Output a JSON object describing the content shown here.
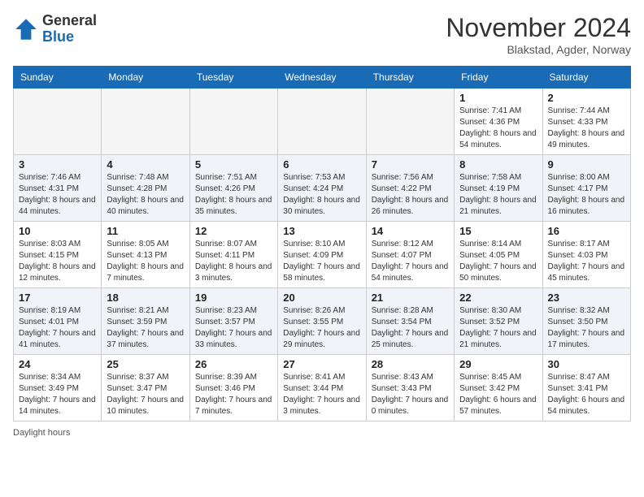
{
  "header": {
    "logo_general": "General",
    "logo_blue": "Blue",
    "month_title": "November 2024",
    "location": "Blakstad, Agder, Norway"
  },
  "days_of_week": [
    "Sunday",
    "Monday",
    "Tuesday",
    "Wednesday",
    "Thursday",
    "Friday",
    "Saturday"
  ],
  "footer": {
    "daylight_label": "Daylight hours"
  },
  "weeks": [
    [
      {
        "day": "",
        "info": ""
      },
      {
        "day": "",
        "info": ""
      },
      {
        "day": "",
        "info": ""
      },
      {
        "day": "",
        "info": ""
      },
      {
        "day": "",
        "info": ""
      },
      {
        "day": "1",
        "info": "Sunrise: 7:41 AM\nSunset: 4:36 PM\nDaylight: 8 hours\nand 54 minutes."
      },
      {
        "day": "2",
        "info": "Sunrise: 7:44 AM\nSunset: 4:33 PM\nDaylight: 8 hours\nand 49 minutes."
      }
    ],
    [
      {
        "day": "3",
        "info": "Sunrise: 7:46 AM\nSunset: 4:31 PM\nDaylight: 8 hours\nand 44 minutes."
      },
      {
        "day": "4",
        "info": "Sunrise: 7:48 AM\nSunset: 4:28 PM\nDaylight: 8 hours\nand 40 minutes."
      },
      {
        "day": "5",
        "info": "Sunrise: 7:51 AM\nSunset: 4:26 PM\nDaylight: 8 hours\nand 35 minutes."
      },
      {
        "day": "6",
        "info": "Sunrise: 7:53 AM\nSunset: 4:24 PM\nDaylight: 8 hours\nand 30 minutes."
      },
      {
        "day": "7",
        "info": "Sunrise: 7:56 AM\nSunset: 4:22 PM\nDaylight: 8 hours\nand 26 minutes."
      },
      {
        "day": "8",
        "info": "Sunrise: 7:58 AM\nSunset: 4:19 PM\nDaylight: 8 hours\nand 21 minutes."
      },
      {
        "day": "9",
        "info": "Sunrise: 8:00 AM\nSunset: 4:17 PM\nDaylight: 8 hours\nand 16 minutes."
      }
    ],
    [
      {
        "day": "10",
        "info": "Sunrise: 8:03 AM\nSunset: 4:15 PM\nDaylight: 8 hours\nand 12 minutes."
      },
      {
        "day": "11",
        "info": "Sunrise: 8:05 AM\nSunset: 4:13 PM\nDaylight: 8 hours\nand 7 minutes."
      },
      {
        "day": "12",
        "info": "Sunrise: 8:07 AM\nSunset: 4:11 PM\nDaylight: 8 hours\nand 3 minutes."
      },
      {
        "day": "13",
        "info": "Sunrise: 8:10 AM\nSunset: 4:09 PM\nDaylight: 7 hours\nand 58 minutes."
      },
      {
        "day": "14",
        "info": "Sunrise: 8:12 AM\nSunset: 4:07 PM\nDaylight: 7 hours\nand 54 minutes."
      },
      {
        "day": "15",
        "info": "Sunrise: 8:14 AM\nSunset: 4:05 PM\nDaylight: 7 hours\nand 50 minutes."
      },
      {
        "day": "16",
        "info": "Sunrise: 8:17 AM\nSunset: 4:03 PM\nDaylight: 7 hours\nand 45 minutes."
      }
    ],
    [
      {
        "day": "17",
        "info": "Sunrise: 8:19 AM\nSunset: 4:01 PM\nDaylight: 7 hours\nand 41 minutes."
      },
      {
        "day": "18",
        "info": "Sunrise: 8:21 AM\nSunset: 3:59 PM\nDaylight: 7 hours\nand 37 minutes."
      },
      {
        "day": "19",
        "info": "Sunrise: 8:23 AM\nSunset: 3:57 PM\nDaylight: 7 hours\nand 33 minutes."
      },
      {
        "day": "20",
        "info": "Sunrise: 8:26 AM\nSunset: 3:55 PM\nDaylight: 7 hours\nand 29 minutes."
      },
      {
        "day": "21",
        "info": "Sunrise: 8:28 AM\nSunset: 3:54 PM\nDaylight: 7 hours\nand 25 minutes."
      },
      {
        "day": "22",
        "info": "Sunrise: 8:30 AM\nSunset: 3:52 PM\nDaylight: 7 hours\nand 21 minutes."
      },
      {
        "day": "23",
        "info": "Sunrise: 8:32 AM\nSunset: 3:50 PM\nDaylight: 7 hours\nand 17 minutes."
      }
    ],
    [
      {
        "day": "24",
        "info": "Sunrise: 8:34 AM\nSunset: 3:49 PM\nDaylight: 7 hours\nand 14 minutes."
      },
      {
        "day": "25",
        "info": "Sunrise: 8:37 AM\nSunset: 3:47 PM\nDaylight: 7 hours\nand 10 minutes."
      },
      {
        "day": "26",
        "info": "Sunrise: 8:39 AM\nSunset: 3:46 PM\nDaylight: 7 hours\nand 7 minutes."
      },
      {
        "day": "27",
        "info": "Sunrise: 8:41 AM\nSunset: 3:44 PM\nDaylight: 7 hours\nand 3 minutes."
      },
      {
        "day": "28",
        "info": "Sunrise: 8:43 AM\nSunset: 3:43 PM\nDaylight: 7 hours\nand 0 minutes."
      },
      {
        "day": "29",
        "info": "Sunrise: 8:45 AM\nSunset: 3:42 PM\nDaylight: 6 hours\nand 57 minutes."
      },
      {
        "day": "30",
        "info": "Sunrise: 8:47 AM\nSunset: 3:41 PM\nDaylight: 6 hours\nand 54 minutes."
      }
    ]
  ]
}
